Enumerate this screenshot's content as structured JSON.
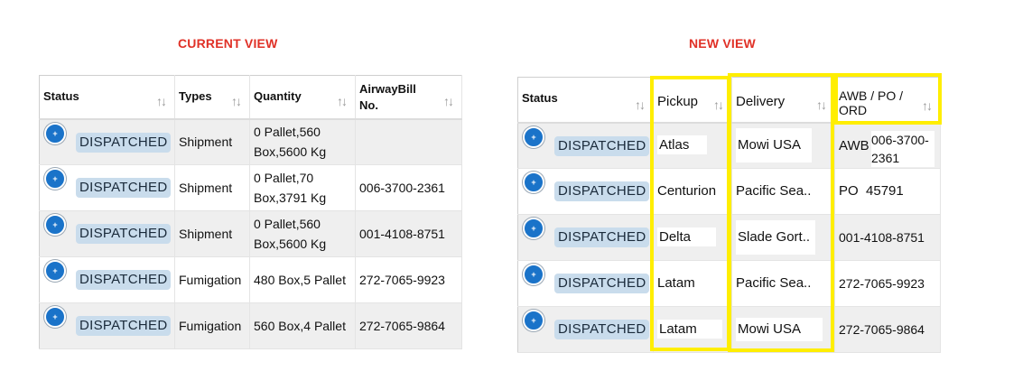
{
  "current_view": {
    "title": "CURRENT VIEW",
    "headers": {
      "status": "Status",
      "types": "Types",
      "quantity": "Quantity",
      "awb": "AirwayBill No."
    },
    "rows": [
      {
        "status": "DISPATCHED",
        "type": "Shipment",
        "quantity": "0 Pallet,560 Box,5600 Kg",
        "awb": ""
      },
      {
        "status": "DISPATCHED",
        "type": "Shipment",
        "quantity": "0 Pallet,70 Box,3791 Kg",
        "awb": "006-3700-2361"
      },
      {
        "status": "DISPATCHED",
        "type": "Shipment",
        "quantity": "0 Pallet,560 Box,5600 Kg",
        "awb": "001-4108-8751"
      },
      {
        "status": "DISPATCHED",
        "type": "Fumigation",
        "quantity": "480 Box,5 Pallet",
        "awb": "272-7065-9923"
      },
      {
        "status": "DISPATCHED",
        "type": "Fumigation",
        "quantity": "560 Box,4 Pallet",
        "awb": "272-7065-9864"
      }
    ]
  },
  "new_view": {
    "title": "NEW VIEW",
    "headers": {
      "status": "Status",
      "pickup": "Pickup",
      "delivery": "Delivery",
      "awb": "AWB / PO / ORD"
    },
    "rows": [
      {
        "status": "DISPATCHED",
        "pickup": "Atlas",
        "delivery": "Mowi USA",
        "awb_prefix": "AWB",
        "awb": "006-3700-2361"
      },
      {
        "status": "DISPATCHED",
        "pickup": "Centurion",
        "delivery": "Pacific Sea..",
        "awb_prefix": "PO",
        "awb": "45791"
      },
      {
        "status": "DISPATCHED",
        "pickup": "Delta",
        "delivery": "Slade Gort..",
        "awb_prefix": "",
        "awb": "001-4108-8751"
      },
      {
        "status": "DISPATCHED",
        "pickup": "Latam",
        "delivery": "Pacific Sea..",
        "awb_prefix": "",
        "awb": "272-7065-9923"
      },
      {
        "status": "DISPATCHED",
        "pickup": "Latam",
        "delivery": "Mowi USA",
        "awb_prefix": "",
        "awb": "272-7065-9864"
      }
    ]
  },
  "icons": {
    "sort": "sort-arrows-icon",
    "expand": "expand-plus-icon"
  },
  "colors": {
    "title": "#e03127",
    "badge_bg": "#c9dcec",
    "expand_btn": "#1a73c9",
    "highlight": "#ffee00"
  }
}
